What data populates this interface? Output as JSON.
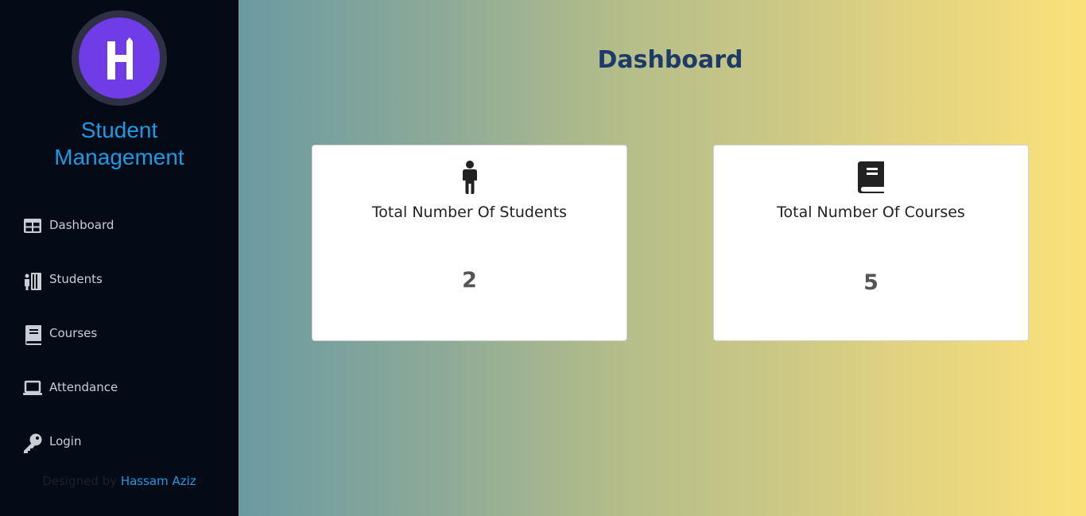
{
  "sidebar": {
    "brand_line1": "Student",
    "brand_line2": "Management",
    "logo_letter": "H",
    "items": [
      {
        "label": "Dashboard",
        "icon": "dashboard-table-icon"
      },
      {
        "label": "Students",
        "icon": "students-icon"
      },
      {
        "label": "Courses",
        "icon": "book-icon"
      },
      {
        "label": "Attendance",
        "icon": "laptop-icon"
      },
      {
        "label": "Login",
        "icon": "key-icon"
      }
    ],
    "credit_prefix": "Designed by",
    "credit_author": "Hassam Aziz"
  },
  "main": {
    "title": "Dashboard",
    "cards": [
      {
        "title": "Total Number Of Students",
        "value": "2",
        "icon": "person-icon"
      },
      {
        "title": "Total Number Of Courses",
        "value": "5",
        "icon": "book-icon"
      }
    ]
  },
  "colors": {
    "sidebar_bg": "#040b16",
    "brand": "#1b9ae6",
    "logo": "#6f3ce8",
    "title": "#1e3a66"
  }
}
